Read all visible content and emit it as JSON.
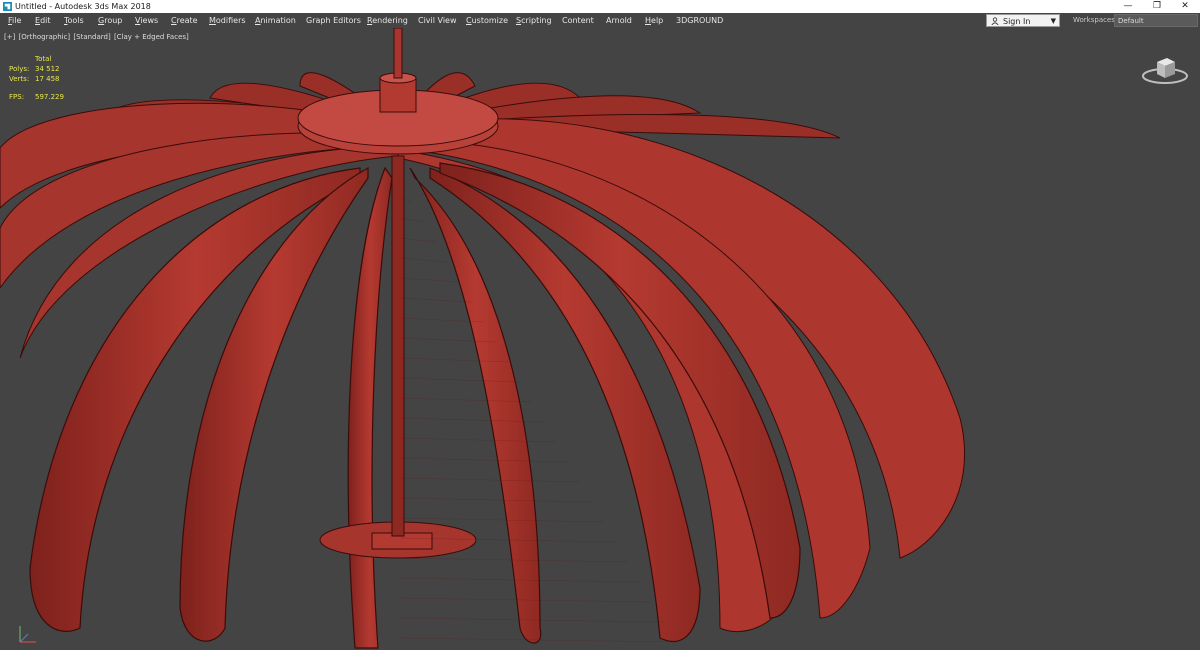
{
  "titlebar": {
    "title": "Untitled - Autodesk 3ds Max 2018",
    "minimize": "—",
    "restore": "❐",
    "close": "✕"
  },
  "menu": {
    "items": [
      {
        "label": "File",
        "mnemonic": "F",
        "rest": "ile"
      },
      {
        "label": "Edit",
        "mnemonic": "E",
        "rest": "dit"
      },
      {
        "label": "Tools",
        "mnemonic": "T",
        "rest": "ools"
      },
      {
        "label": "Group",
        "mnemonic": "G",
        "rest": "roup"
      },
      {
        "label": "Views",
        "mnemonic": "V",
        "rest": "iews"
      },
      {
        "label": "Create",
        "mnemonic": "C",
        "rest": "reate"
      },
      {
        "label": "Modifiers",
        "mnemonic": "M",
        "rest": "odifiers"
      },
      {
        "label": "Animation",
        "mnemonic": "A",
        "rest": "nimation"
      },
      {
        "label": "Graph Editors",
        "mnemonic": "",
        "rest": "Graph Editors"
      },
      {
        "label": "Rendering",
        "mnemonic": "R",
        "rest": "endering"
      },
      {
        "label": "Civil View",
        "mnemonic": "",
        "rest": "Civil View"
      },
      {
        "label": "Customize",
        "mnemonic": "C",
        "rest": "ustomize"
      },
      {
        "label": "Scripting",
        "mnemonic": "S",
        "rest": "cripting"
      },
      {
        "label": "Content",
        "mnemonic": "",
        "rest": "Content"
      },
      {
        "label": "Arnold",
        "mnemonic": "",
        "rest": "Arnold"
      },
      {
        "label": "Help",
        "mnemonic": "H",
        "rest": "elp"
      },
      {
        "label": "3DGROUND",
        "mnemonic": "",
        "rest": "3DGROUND"
      }
    ],
    "signin": "Sign In",
    "workspaces_label": "Workspaces:",
    "workspace_value": "Default"
  },
  "viewport": {
    "labels": [
      "[+]",
      "[Orthographic]",
      "[Standard]",
      "[Clay + Edged Faces]"
    ],
    "stats": {
      "header": "Total",
      "rows": [
        {
          "key": "Polys:",
          "value": "34 512"
        },
        {
          "key": "Verts:",
          "value": "17 458"
        },
        {
          "key": "FPS:",
          "value": "597.229"
        }
      ]
    }
  },
  "colors": {
    "viewport_bg": "#444444",
    "model_fill": "#a9362e",
    "model_edge": "#3a0c0a",
    "stats_text": "#e8e84a"
  },
  "icons": {
    "app": "3dsmax-app-icon",
    "user": "user-icon",
    "viewcube": "viewcube-icon",
    "axis": "axis-tripod-icon"
  }
}
